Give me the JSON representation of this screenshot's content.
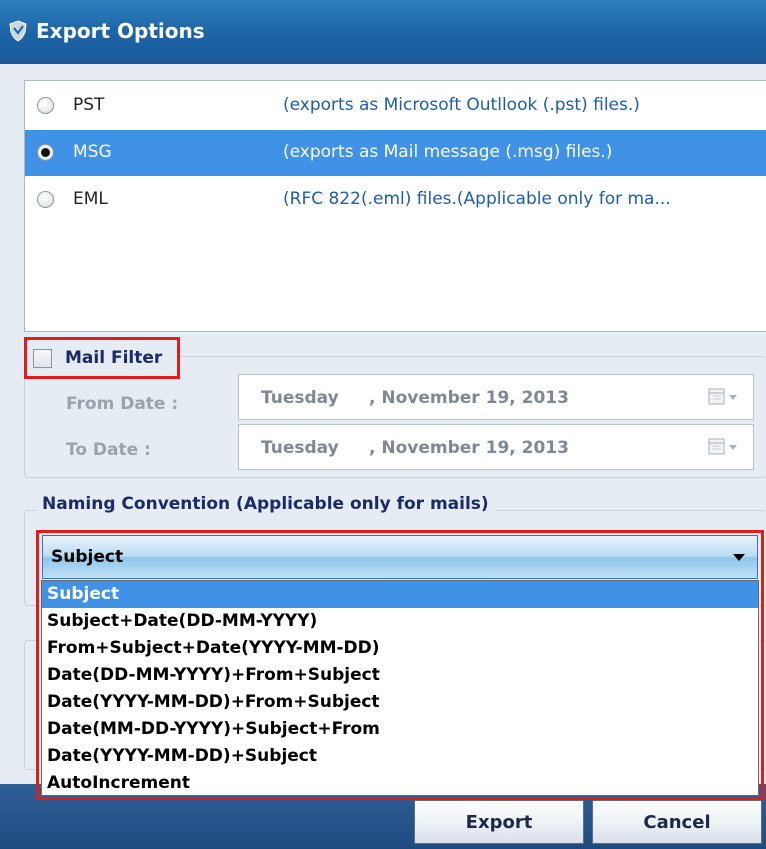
{
  "window": {
    "title": "Export Options",
    "app_icon": "shield-app-icon"
  },
  "formats": [
    {
      "name": "PST",
      "description": "(exports as Microsoft Outllook (.pst) files.)",
      "selected": false
    },
    {
      "name": "MSG",
      "description": "(exports as Mail message (.msg) files.)",
      "selected": true
    },
    {
      "name": "EML",
      "description": "(RFC 822(.eml) files.(Applicable only for ma...",
      "selected": false
    }
  ],
  "mail_filter": {
    "label": "Mail Filter",
    "checked": false,
    "from_label": "From Date :",
    "to_label": "To Date :",
    "from_day": "Tuesday",
    "from_date": ", November 19, 2013",
    "to_day": "Tuesday",
    "to_date": ", November 19, 2013"
  },
  "naming": {
    "title": "Naming Convention (Applicable only for mails)",
    "selected": "Subject",
    "options": [
      "Subject",
      "Subject+Date(DD-MM-YYYY)",
      "From+Subject+Date(YYYY-MM-DD)",
      "Date(DD-MM-YYYY)+From+Subject",
      "Date(YYYY-MM-DD)+From+Subject",
      "Date(MM-DD-YYYY)+Subject+From",
      "Date(YYYY-MM-DD)+Subject",
      "AutoIncrement"
    ]
  },
  "buttons": {
    "export": "Export",
    "cancel": "Cancel"
  },
  "colors": {
    "title_bar": "#1c63a5",
    "selection": "#3f92e6",
    "highlight_outline": "#e21b1b"
  }
}
